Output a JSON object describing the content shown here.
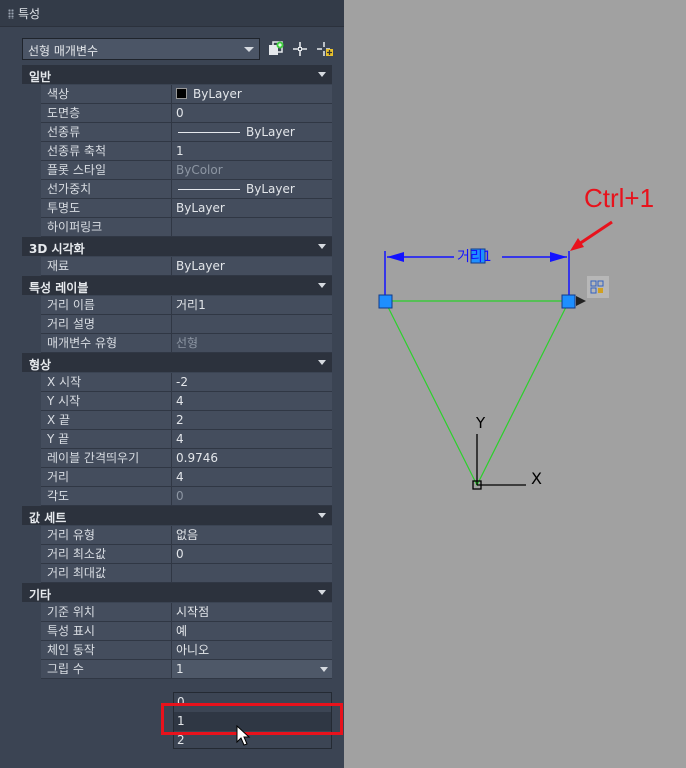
{
  "palette": {
    "title": "특성",
    "object_select": "선형 매개변수"
  },
  "categories": [
    {
      "label": "일반",
      "rows": [
        {
          "name": "색상",
          "value": "ByLayer",
          "swatch": true
        },
        {
          "name": "도면층",
          "value": "0"
        },
        {
          "name": "선종류",
          "value": "ByLayer",
          "line": true
        },
        {
          "name": "선종류 축척",
          "value": "1"
        },
        {
          "name": "플롯 스타일",
          "value": "ByColor",
          "dim": true
        },
        {
          "name": "선가중치",
          "value": "ByLayer",
          "line": true
        },
        {
          "name": "투명도",
          "value": "ByLayer"
        },
        {
          "name": "하이퍼링크",
          "value": ""
        }
      ]
    },
    {
      "label": "3D 시각화",
      "rows": [
        {
          "name": "재료",
          "value": "ByLayer"
        }
      ]
    },
    {
      "label": "특성 레이블",
      "rows": [
        {
          "name": "거리 이름",
          "value": "거리1"
        },
        {
          "name": "거리 설명",
          "value": ""
        },
        {
          "name": "매개변수 유형",
          "value": "선형",
          "dim": true
        }
      ]
    },
    {
      "label": "형상",
      "rows": [
        {
          "name": "X 시작",
          "value": "-2"
        },
        {
          "name": "Y 시작",
          "value": "4"
        },
        {
          "name": "X 끝",
          "value": "2"
        },
        {
          "name": "Y 끝",
          "value": "4"
        },
        {
          "name": "레이블 간격띄우기",
          "value": "0.9746"
        },
        {
          "name": "거리",
          "value": "4"
        },
        {
          "name": "각도",
          "value": "0",
          "dim": true
        }
      ]
    },
    {
      "label": "값 세트",
      "rows": [
        {
          "name": "거리 유형",
          "value": "없음"
        },
        {
          "name": "거리 최소값",
          "value": "0"
        },
        {
          "name": "거리 최대값",
          "value": ""
        }
      ]
    },
    {
      "label": "기타",
      "rows": [
        {
          "name": "기준 위치",
          "value": "시작점"
        },
        {
          "name": "특성 표시",
          "value": "예"
        },
        {
          "name": "체인 동작",
          "value": "아니오"
        },
        {
          "name": "그립 수",
          "value": "1",
          "dropdown": true
        }
      ]
    }
  ],
  "dropdown_options": [
    "0",
    "1",
    "2"
  ],
  "dropdown_highlight": 1,
  "canvas": {
    "annotation": "Ctrl+1",
    "dim_label": "거리1",
    "axis_x": "X",
    "axis_y": "Y",
    "colors": {
      "annotation": "#e8121c",
      "dimension": "#1212ff",
      "triangle": "#2bd12b",
      "grip": "#1e8fff"
    }
  }
}
